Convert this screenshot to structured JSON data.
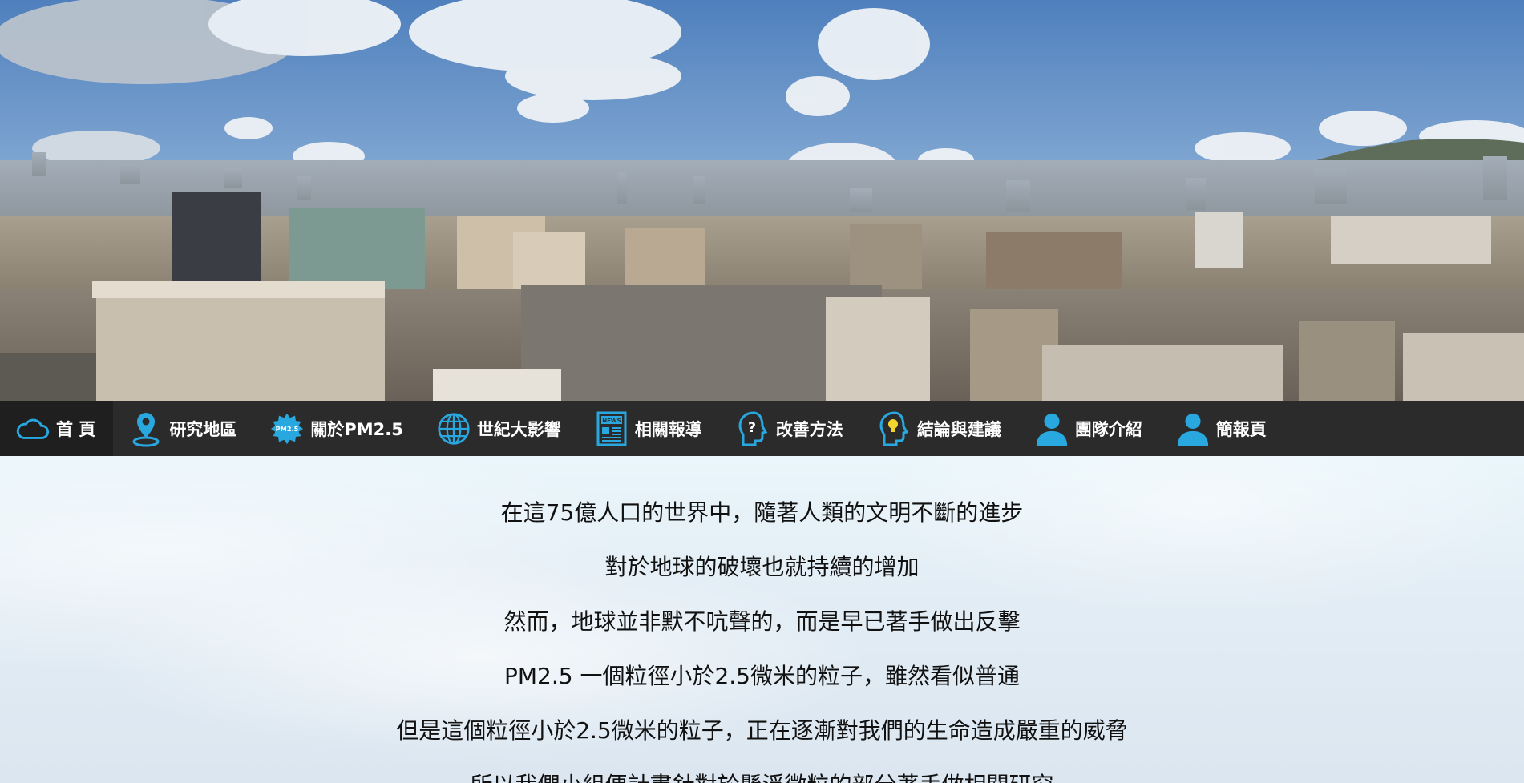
{
  "nav": {
    "items": [
      {
        "label": "首 頁",
        "icon": "cloud-icon"
      },
      {
        "label": "研究地區",
        "icon": "map-pin-icon"
      },
      {
        "label": "關於PM2.5",
        "icon": "pm25-badge-icon",
        "badge_text": "PM2.5"
      },
      {
        "label": "世紀大影響",
        "icon": "globe-icon"
      },
      {
        "label": "相關報導",
        "icon": "news-icon",
        "badge_text": "NEWS"
      },
      {
        "label": "改善方法",
        "icon": "question-head-icon"
      },
      {
        "label": "結論與建議",
        "icon": "lightbulb-head-icon"
      },
      {
        "label": "團隊介紹",
        "icon": "person-icon"
      },
      {
        "label": "簡報頁",
        "icon": "person-icon"
      }
    ]
  },
  "intro": {
    "lines": [
      "在這75億人口的世界中，隨著人類的文明不斷的進步",
      "對於地球的破壞也就持續的增加",
      "然而，地球並非默不吭聲的，而是早已著手做出反擊",
      "PM2.5 一個粒徑小於2.5微米的粒子，雖然看似普通",
      "但是這個粒徑小於2.5微米的粒子，正在逐漸對我們的生命造成嚴重的威脅",
      "所以我們小組便計畫針對於懸浮微粒的部分著手做相關研究"
    ]
  },
  "colors": {
    "nav_background": "#2b2b2b",
    "nav_active": "#1f1f1f",
    "icon_blue": "#29a8e0",
    "nav_text": "#ffffff",
    "body_text": "#111111"
  }
}
